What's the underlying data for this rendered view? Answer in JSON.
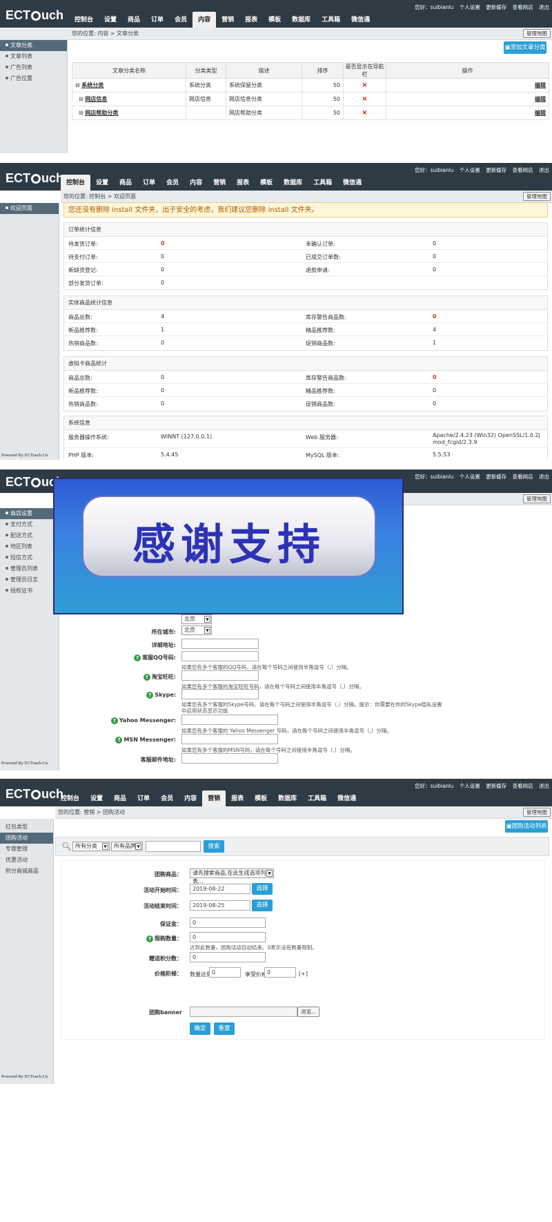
{
  "top_links": [
    "您好：suibianlu",
    "个人设置",
    "更新缓存",
    "查看网店",
    "退出"
  ],
  "nav_tabs": [
    "控制台",
    "设置",
    "商品",
    "订单",
    "会员",
    "内容",
    "营销",
    "报表",
    "模板",
    "数据库",
    "工具箱",
    "微信通"
  ],
  "admin_button": "管理地图",
  "footer": "Powered By ECTouch.Cn",
  "shot1": {
    "breadcrumb": "您的位置: 内容 > 文章分类",
    "sidebar": [
      "文章分类",
      "文章列表",
      "广告列表",
      "广告位置"
    ],
    "add_button": "添加文章分类",
    "columns": [
      "文章分类名称",
      "分类类型",
      "描述",
      "排序",
      "是否显示在导航栏",
      "操作"
    ],
    "rows": [
      {
        "name": "系统分类",
        "type": "系统分类",
        "desc": "系统保留分类",
        "order": "50",
        "nav": "×",
        "op": "编辑"
      },
      {
        "name": "网店信息",
        "type": "网店信息",
        "desc": "网店信息分类",
        "order": "50",
        "nav": "×",
        "op": "编辑"
      },
      {
        "name": "网店帮助分类",
        "type": "",
        "desc": "网店帮助分类",
        "order": "50",
        "nav": "×",
        "op": "编辑"
      }
    ]
  },
  "shot2": {
    "breadcrumb": "您的位置: 控制台 > 欢迎页面",
    "sidebar": [
      "欢迎页面"
    ],
    "warning": "您还没有删除 install 文件夹，出于安全的考虑，我们建议您删除 install 文件夹。",
    "order_section": {
      "title": "订单统计信息",
      "rows": [
        [
          "待发货订单:",
          "0",
          "未确认订单:",
          "0"
        ],
        [
          "待支付订单:",
          "0",
          "已成交订单数:",
          "0"
        ],
        [
          "新缺货登记:",
          "0",
          "退款申请:",
          "0"
        ],
        [
          "部分发货订单:",
          "0",
          "",
          ""
        ]
      ]
    },
    "goods_section": {
      "title": "实体商品统计信息",
      "rows": [
        [
          "商品总数:",
          "4",
          "库存警告商品数:",
          "0"
        ],
        [
          "新品推荐数:",
          "1",
          "精品推荐数:",
          "4"
        ],
        [
          "热销商品数:",
          "0",
          "促销商品数:",
          "1"
        ]
      ]
    },
    "virtual_section": {
      "title": "虚拟卡商品统计",
      "rows": [
        [
          "商品总数:",
          "0",
          "库存警告商品数:",
          "0"
        ],
        [
          "新品推荐数:",
          "0",
          "精品推荐数:",
          "0"
        ],
        [
          "热销商品数:",
          "0",
          "促销商品数:",
          "0"
        ]
      ]
    },
    "system_section": {
      "title": "系统信息",
      "rows": [
        [
          "服务器操作系统:",
          "WINNT (127.0.0.1)",
          "Web 服务器:",
          "Apache/2.4.23 (Win32) OpenSSL/1.0.2j mod_fcgid/2.3.9"
        ],
        [
          "PHP 版本:",
          "5.4.45",
          "MySQL 版本:",
          "5.5.53"
        ]
      ]
    }
  },
  "shot3": {
    "sidebar": [
      "商店设置",
      "支付方式",
      "配送方式",
      "地区列表",
      "短信方式",
      "管理员列表",
      "管理员日志",
      "授权证书"
    ],
    "banner_text": "感谢支持",
    "city_label": "所在城市:",
    "province_value": "北京",
    "city_value": "北京",
    "address_label": "详细地址:",
    "qq_label": "客服QQ号码:",
    "qq_help": "如果您有多个客服的QQ号码，请在每个号码之间使用半角逗号（,）分隔。",
    "ww_label": "淘宝旺旺:",
    "ww_help": "如果您有多个客服的淘宝旺旺号码，请在每个号码之间使用半角逗号（,）分隔。",
    "skype_label": "Skype:",
    "skype_help": "如果您有多个客服的Skype号码，请在每个号码之间使用半角逗号（,）分隔。提示：你需要在你的Skype隐私设置中启用状态显示功能",
    "yahoo_label": "Yahoo Messenger:",
    "yahoo_help": "如果您有多个客服的 Yahoo Messenger 号码，请在每个号码之间使用半角逗号（,）分隔。",
    "msn_label": "MSN Messenger:",
    "msn_help": "如果您有多个客服的MSN号码，请在每个号码之间使用半角逗号（,）分隔。",
    "email_label": "客服邮件地址:"
  },
  "shot4": {
    "breadcrumb": "您的位置: 营销 > 团购活动",
    "sidebar": [
      "红包类型",
      "团购活动",
      "专题管理",
      "优惠活动",
      "积分商城商品"
    ],
    "list_button": "团购活动列表",
    "filter_cat": "所有分类",
    "filter_brand": "所有品牌",
    "search_button": "搜索",
    "goods_label": "团购商品：",
    "goods_select": "请先搜索商品,在此生成选项列表...",
    "start_label": "活动开始时间：",
    "start_value": "2019-08-22",
    "end_label": "活动结束时间：",
    "end_value": "2019-08-25",
    "pick_button": "选择",
    "deposit_label": "保证金：",
    "deposit_value": "0",
    "limit_label": "限购数量：",
    "limit_value": "0",
    "limit_help": "达到此数量，团购活动自动结束。0表示没有数量限制。",
    "points_label": "赠送积分数：",
    "points_value": "0",
    "ladder_label": "价格阶梯：",
    "ladder_qty_label": "数量达到",
    "ladder_qty_value": "0",
    "ladder_price_label": "享受价格",
    "ladder_price_value": "0",
    "ladder_add": "[+]",
    "banner_label": "团购banner",
    "browse_button": "浏览...",
    "ok_button": "确定",
    "reset_button": "重置"
  }
}
